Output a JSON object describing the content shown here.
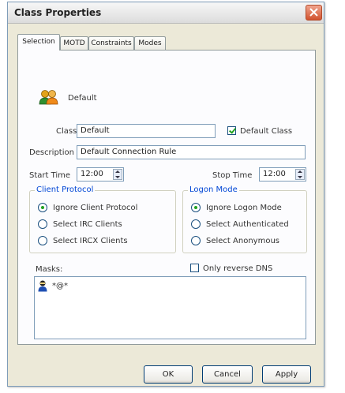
{
  "window": {
    "title": "Class Properties"
  },
  "tabs": [
    {
      "label": "Selection",
      "active": true
    },
    {
      "label": "MOTD"
    },
    {
      "label": "Constraints"
    },
    {
      "label": "Modes"
    }
  ],
  "header": {
    "icon": "users-icon",
    "name": "Default"
  },
  "form": {
    "class_label": "Class",
    "class_value": "Default",
    "default_class_label": "Default Class",
    "default_class_checked": true,
    "description_label": "Description",
    "description_value": "Default Connection Rule",
    "start_time_label": "Start Time",
    "start_time_value": "12:00",
    "stop_time_label": "Stop Time",
    "stop_time_value": "12:00"
  },
  "client_protocol": {
    "title": "Client Protocol",
    "options": [
      {
        "label": "Ignore Client Protocol",
        "checked": true
      },
      {
        "label": "Select IRC Clients",
        "checked": false
      },
      {
        "label": "Select IRCX Clients",
        "checked": false
      }
    ]
  },
  "logon_mode": {
    "title": "Logon Mode",
    "options": [
      {
        "label": "Ignore Logon Mode",
        "checked": true
      },
      {
        "label": "Select Authenticated",
        "checked": false
      },
      {
        "label": "Select Anonymous",
        "checked": false
      }
    ]
  },
  "masks": {
    "label": "Masks:",
    "only_reverse_dns_label": "Only reverse DNS",
    "only_reverse_dns_checked": false,
    "items": [
      {
        "icon": "user-mask-icon",
        "text": "*@*"
      }
    ]
  },
  "buttons": {
    "ok": "OK",
    "cancel": "Cancel",
    "apply": "Apply"
  },
  "colors": {
    "accent": "#0046d5",
    "check": "#21a121",
    "dialog_bg": "#ece9d8"
  }
}
